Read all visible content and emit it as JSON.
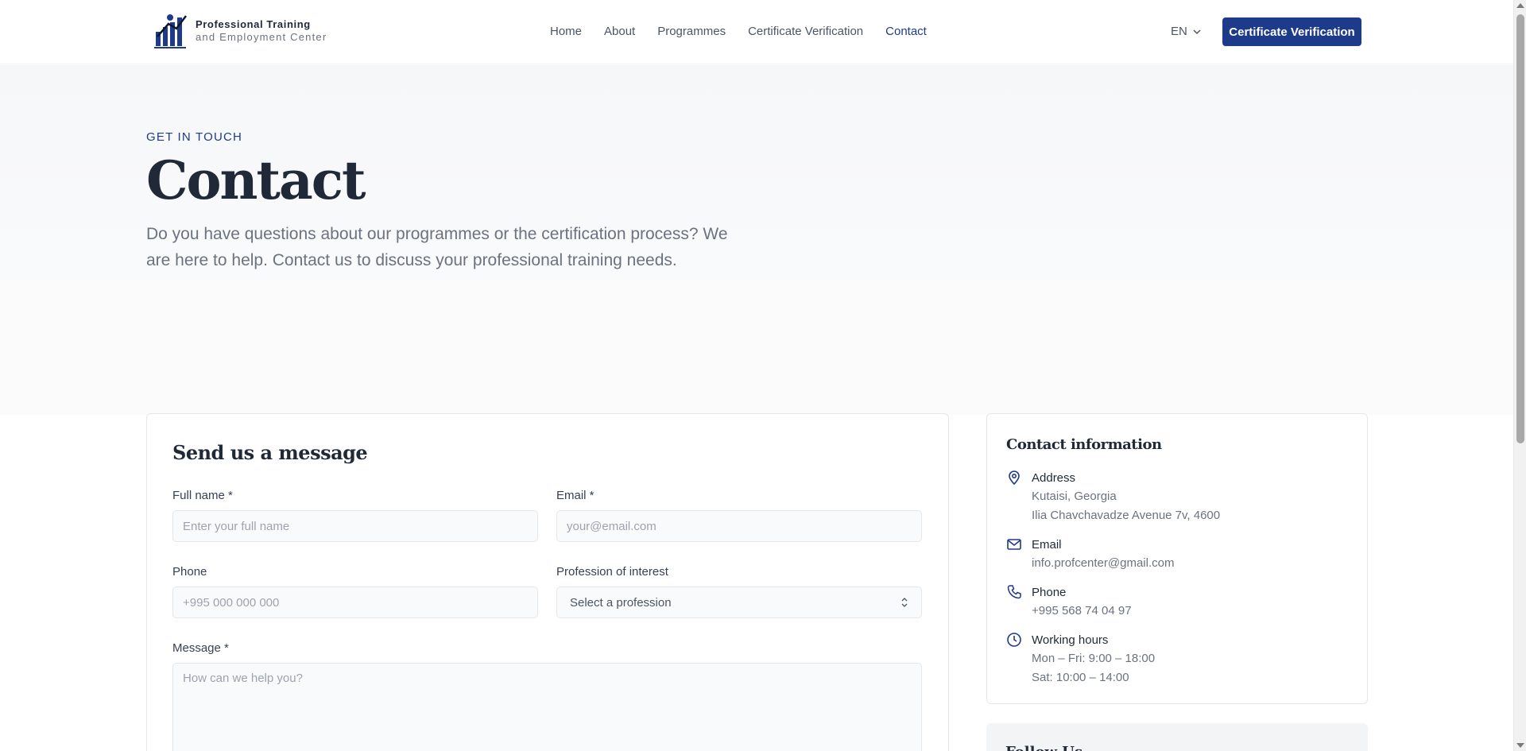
{
  "header": {
    "logo_line1": "Professional Training",
    "logo_line2": "and Employment Center",
    "nav": [
      "Home",
      "About",
      "Programmes",
      "Certificate Verification",
      "Contact"
    ],
    "active_nav": "Contact",
    "language": "EN",
    "cta_label": "Certificate Verification"
  },
  "hero": {
    "eyebrow": "GET IN TOUCH",
    "title": "Contact",
    "lead": "Do you have questions about our programmes or the certification process? We are here to help. Contact us to discuss your professional training needs."
  },
  "form": {
    "title": "Send us a message",
    "full_name_label": "Full name *",
    "full_name_placeholder": "Enter your full name",
    "email_label": "Email *",
    "email_placeholder": "your@email.com",
    "phone_label": "Phone",
    "phone_placeholder": "+995 000 000 000",
    "profession_label": "Profession of interest",
    "profession_selected": "Select a profession",
    "message_label": "Message *",
    "message_placeholder": "How can we help you?"
  },
  "contact_info": {
    "title": "Contact information",
    "address_label": "Address",
    "address_line1": "Kutaisi, Georgia",
    "address_line2": "Ilia Chavchavadze Avenue 7v, 4600",
    "email_label": "Email",
    "email_value": "info.profcenter@gmail.com",
    "phone_label": "Phone",
    "phone_value": "+995 568 74 04 97",
    "hours_label": "Working hours",
    "hours_line1": "Mon – Fri: 9:00 – 18:00",
    "hours_line2": "Sat: 10:00 – 14:00"
  },
  "follow": {
    "title": "Follow Us"
  },
  "colors": {
    "brand": "#1e3a8a",
    "text": "#1f2937",
    "muted": "#6b7280"
  },
  "icons": [
    "logo-mark-icon",
    "chevron-down-icon",
    "map-pin-icon",
    "mail-icon",
    "phone-icon",
    "clock-icon",
    "select-updown-icon"
  ]
}
